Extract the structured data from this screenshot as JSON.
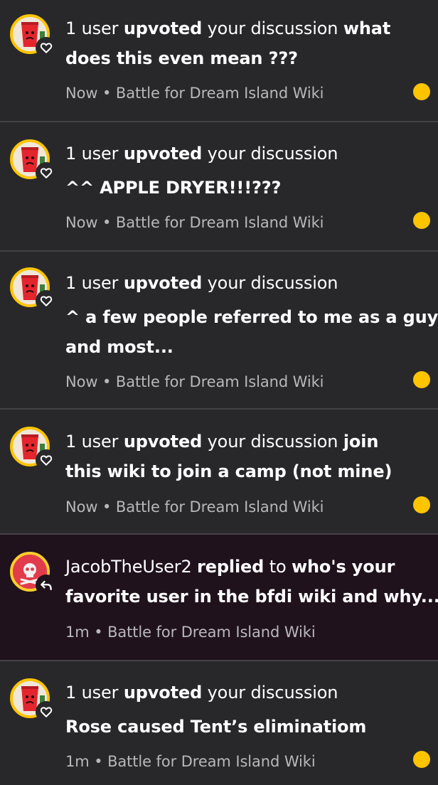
{
  "notifications": [
    {
      "type": "upvote",
      "actor": "1 user",
      "verb": "upvoted",
      "connector": "your discussion",
      "title_line1": "what",
      "title_line2": "does this even mean ???",
      "time": "Now",
      "separator": "•",
      "wiki": "Battle for Dream Island Wiki",
      "unread": true,
      "avatar_icon": "red-cup-icon",
      "badge_icon": "heart-icon"
    },
    {
      "type": "upvote",
      "actor": "1 user",
      "verb": "upvoted",
      "connector": "your discussion",
      "title_line2": "^^ APPLE DRYER!!!???",
      "time": "Now",
      "separator": "•",
      "wiki": "Battle for Dream Island Wiki",
      "unread": true,
      "avatar_icon": "red-cup-icon",
      "badge_icon": "heart-icon"
    },
    {
      "type": "upvote",
      "actor": "1 user",
      "verb": "upvoted",
      "connector": "your discussion",
      "title_line2": "^ a few people referred to me as a guy",
      "title_line3": "and most...",
      "time": "Now",
      "separator": "•",
      "wiki": "Battle for Dream Island Wiki",
      "unread": true,
      "avatar_icon": "red-cup-icon",
      "badge_icon": "heart-icon"
    },
    {
      "type": "upvote",
      "actor": "1 user",
      "verb": "upvoted",
      "connector": "your discussion",
      "title_line1": "join",
      "title_line2": "this wiki to join a camp (not mine)",
      "time": "Now",
      "separator": "•",
      "wiki": "Battle for Dream Island Wiki",
      "unread": true,
      "avatar_icon": "red-cup-icon",
      "badge_icon": "heart-icon"
    },
    {
      "type": "reply",
      "actor": "JacobTheUser2",
      "verb": "replied",
      "connector": "to",
      "title_line1": "who's your",
      "title_line2": "favorite user in the bfdi wiki and why...",
      "time": "1m",
      "separator": "•",
      "wiki": "Battle for Dream Island Wiki",
      "unread": false,
      "avatar_icon": "skull-icon",
      "badge_icon": "reply-arrow-icon"
    },
    {
      "type": "upvote",
      "actor": "1 user",
      "verb": "upvoted",
      "connector": "your discussion",
      "title_line2": "Rose caused Tent’s eliminatiom",
      "time": "1m",
      "separator": "•",
      "wiki": "Battle for Dream Island Wiki",
      "unread": true,
      "avatar_icon": "red-cup-icon",
      "badge_icon": "heart-icon"
    }
  ],
  "colors": {
    "background": "#28282b",
    "reply_background": "#1f121d",
    "unread_dot": "#ffc400",
    "divider": "#434346",
    "meta_text": "#b8b8bb"
  }
}
